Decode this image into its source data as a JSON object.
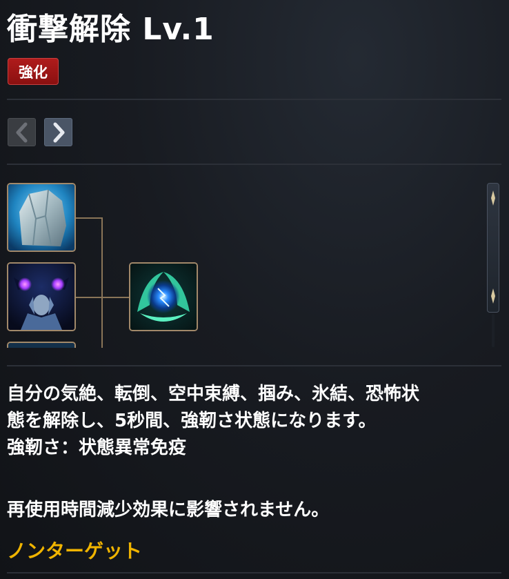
{
  "skill": {
    "title": "衝撃解除 Lv.1",
    "badge": "強化"
  },
  "colors": {
    "badge": "#a01616",
    "target_text": "#f0b400",
    "icon_border": "#a2896a"
  },
  "nav": {
    "prev_icon": "chevron-left-icon",
    "next_icon": "chevron-right-icon"
  },
  "icons": [
    "ice-crystal-skill-icon",
    "fear-skill-icon",
    "stun-release-skill-icon"
  ],
  "description": {
    "line1": "自分の気絶、転倒、空中束縛、掴み、氷結、恐怖状",
    "line2": "態を解除し、5秒間、強靭さ状態になります。",
    "line3": "強靭さ：状態異常免疫",
    "note": "再使用時間減少効果に影響されません。",
    "target": "ノンターゲット"
  }
}
